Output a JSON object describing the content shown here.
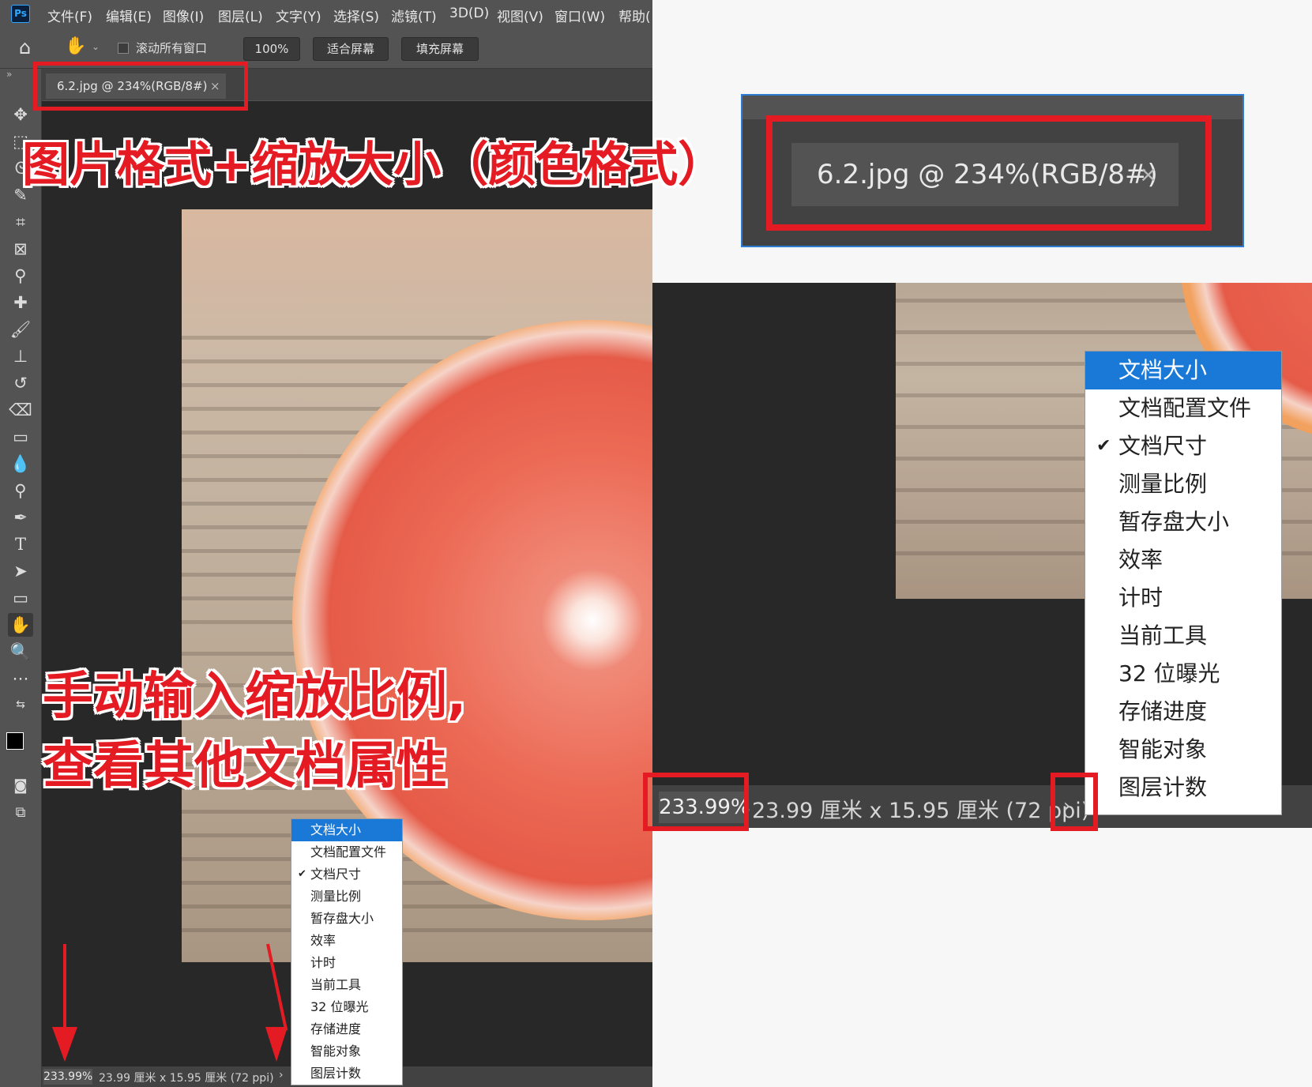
{
  "app": {
    "logo": "Ps",
    "menu": [
      "文件(F)",
      "编辑(E)",
      "图像(I)",
      "图层(L)",
      "文字(Y)",
      "选择(S)",
      "滤镜(T)",
      "3D(D)",
      "视图(V)",
      "窗口(W)",
      "帮助("
    ]
  },
  "options_bar": {
    "scroll_all_label": "滚动所有窗口",
    "zoom_100": "100%",
    "fit_screen": "适合屏幕",
    "fill_screen": "填充屏幕"
  },
  "document_tab": {
    "title": "6.2.jpg @ 234%(RGB/8#)",
    "close": "×"
  },
  "status_bar": {
    "zoom": "233.99%",
    "doc_size": "23.99 厘米 x 15.95 厘米 (72 ppi)",
    "arrow": "›"
  },
  "status_menu": {
    "items": [
      "文档大小",
      "文档配置文件",
      "文档尺寸",
      "测量比例",
      "暂存盘大小",
      "效率",
      "计时",
      "当前工具",
      "32 位曝光",
      "存储进度",
      "智能对象",
      "图层计数"
    ],
    "highlighted": "文档大小",
    "checked": "文档尺寸",
    "check_mark": "✔"
  },
  "annotations": {
    "top_caption": "图片格式+缩放大小（颜色格式）",
    "bottom_caption_line1": "手动输入缩放比例,",
    "bottom_caption_line2": "查看其他文档属性",
    "color": "#e51b23"
  },
  "zoom_status": {
    "zoom": "233.99%",
    "doc_size": "23.99 厘米 x 15.95 厘米 (72 ppi)",
    "arrow": "›"
  }
}
